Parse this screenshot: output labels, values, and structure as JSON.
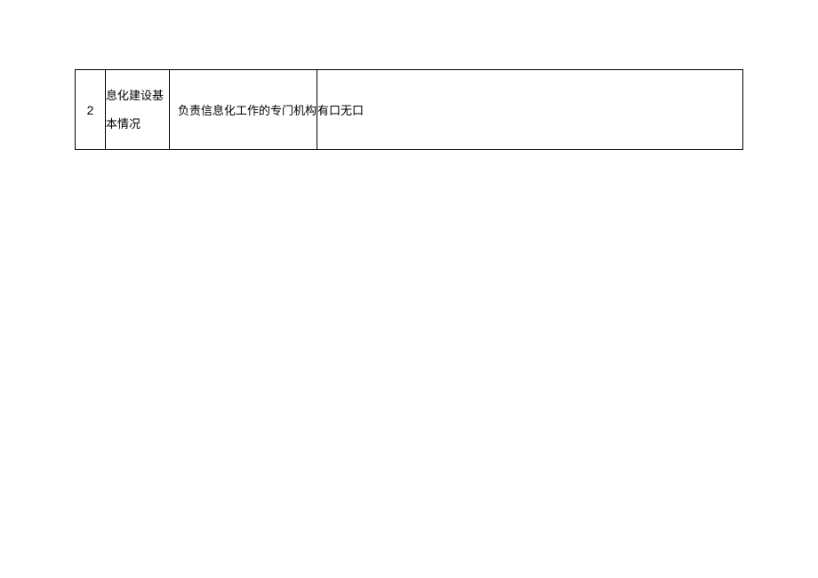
{
  "table": {
    "rows": [
      {
        "number": "2",
        "category": "息化建设基本情况",
        "item": "负责信息化工作的专门机构",
        "value": "有口无口"
      }
    ]
  }
}
